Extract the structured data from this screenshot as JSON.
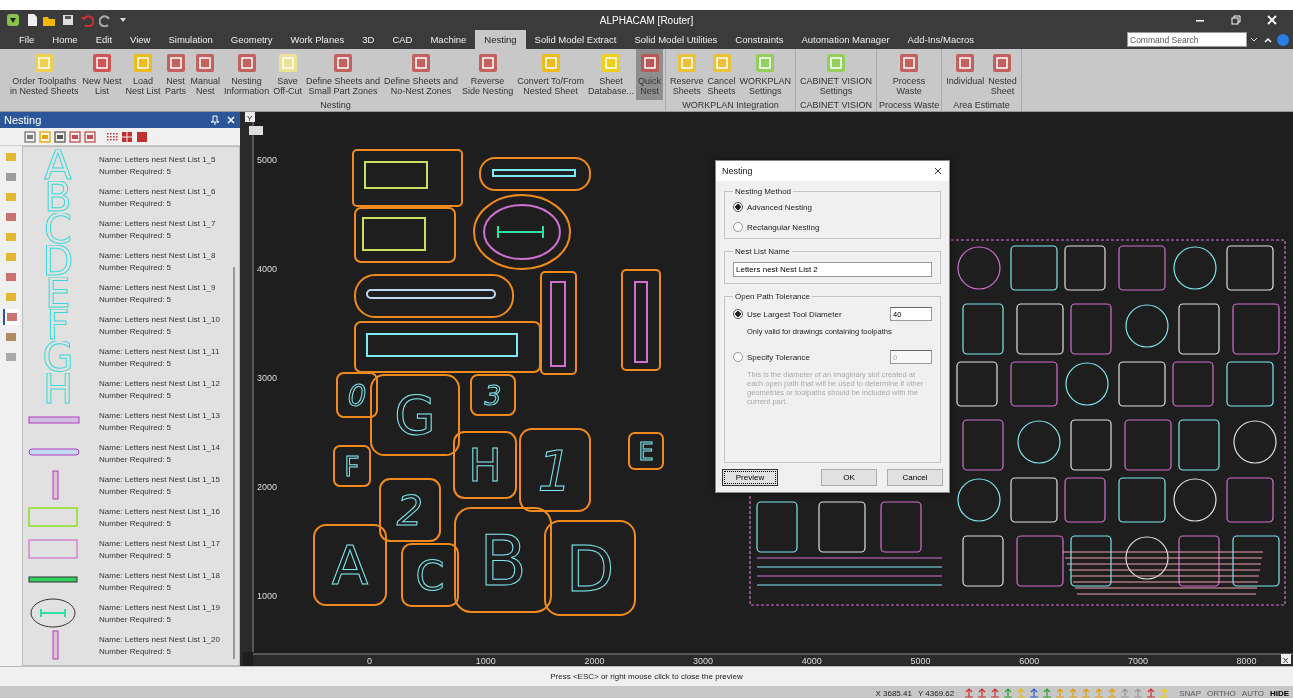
{
  "window": {
    "title": "ALPHACAM [Router]"
  },
  "menu_tabs": [
    {
      "label": "File",
      "selected": false
    },
    {
      "label": "Home",
      "selected": false
    },
    {
      "label": "Edit",
      "selected": false
    },
    {
      "label": "View",
      "selected": false
    },
    {
      "label": "Simulation",
      "selected": false
    },
    {
      "label": "Geometry",
      "selected": false
    },
    {
      "label": "Work Planes",
      "selected": false
    },
    {
      "label": "3D",
      "selected": false
    },
    {
      "label": "CAD",
      "selected": false
    },
    {
      "label": "Machine",
      "selected": false
    },
    {
      "label": "Nesting",
      "selected": true
    },
    {
      "label": "Solid Model Extract",
      "selected": false
    },
    {
      "label": "Solid Model Utilities",
      "selected": false
    },
    {
      "label": "Constraints",
      "selected": false
    },
    {
      "label": "Automation Manager",
      "selected": false
    },
    {
      "label": "Add-Ins/Macros",
      "selected": false
    }
  ],
  "command_search": {
    "placeholder": "Command Search"
  },
  "ribbon_groups": [
    {
      "label": "Nesting",
      "buttons": [
        {
          "label": "Order Toolpaths\nin Nested Sheets",
          "selected": false
        },
        {
          "label": "New Nest\nList",
          "selected": false
        },
        {
          "label": "Load\nNest List",
          "selected": false
        },
        {
          "label": "Nest\nParts",
          "selected": false
        },
        {
          "label": "Manual\nNest",
          "selected": false
        },
        {
          "label": "Nesting\nInformation",
          "selected": false
        },
        {
          "label": "Save\nOff-Cut",
          "selected": false
        },
        {
          "label": "Define Sheets and\nSmall Part Zones",
          "selected": false
        },
        {
          "label": "Define Sheets and\nNo-Nest Zones",
          "selected": false
        },
        {
          "label": "Reverse\nSide Nesting",
          "selected": false
        },
        {
          "label": "Convert To/From\nNested Sheet",
          "selected": false
        },
        {
          "label": "Sheet\nDatabase...",
          "selected": false
        },
        {
          "label": "Quick\nNest",
          "selected": true
        }
      ]
    },
    {
      "label": "WORKPLAN Integration",
      "buttons": [
        {
          "label": "Reserve\nSheets",
          "selected": false
        },
        {
          "label": "Cancel\nSheets",
          "selected": false
        },
        {
          "label": "WORKPLAN\nSettings",
          "selected": false
        }
      ]
    },
    {
      "label": "CABINET VISION",
      "buttons": [
        {
          "label": "CABINET VISION\nSettings",
          "selected": false
        }
      ]
    },
    {
      "label": "Process Waste",
      "buttons": [
        {
          "label": "Process\nWaste",
          "selected": false
        }
      ]
    },
    {
      "label": "Area Estimate",
      "buttons": [
        {
          "label": "Individual",
          "selected": false
        },
        {
          "label": "Nested\nSheet",
          "selected": false
        }
      ]
    }
  ],
  "panel": {
    "title": "Nesting",
    "side_tabs": [
      {
        "selected": false
      },
      {
        "selected": false
      },
      {
        "selected": false
      },
      {
        "selected": false
      },
      {
        "selected": false
      },
      {
        "selected": false
      },
      {
        "selected": false
      },
      {
        "selected": false
      },
      {
        "selected": true
      },
      {
        "selected": false
      },
      {
        "selected": false
      }
    ],
    "items": [
      {
        "name": "Name: Letters nest Nest List 1_5",
        "count": "Number Required: 5",
        "kind": "letter",
        "glyph": "A"
      },
      {
        "name": "Name: Letters nest Nest List 1_6",
        "count": "Number Required: 5",
        "kind": "letter",
        "glyph": "B"
      },
      {
        "name": "Name: Letters nest Nest List 1_7",
        "count": "Number Required: 5",
        "kind": "letter",
        "glyph": "C"
      },
      {
        "name": "Name: Letters nest Nest List 1_8",
        "count": "Number Required: 5",
        "kind": "letter",
        "glyph": "D"
      },
      {
        "name": "Name: Letters nest Nest List 1_9",
        "count": "Number Required: 5",
        "kind": "letter",
        "glyph": "E"
      },
      {
        "name": "Name: Letters nest Nest List 1_10",
        "count": "Number Required: 5",
        "kind": "letter",
        "glyph": "F"
      },
      {
        "name": "Name: Letters nest Nest List 1_11",
        "count": "Number Required: 5",
        "kind": "letter",
        "glyph": "G"
      },
      {
        "name": "Name: Letters nest Nest List 1_12",
        "count": "Number Required: 5",
        "kind": "letter",
        "glyph": "H"
      },
      {
        "name": "Name: Letters nest Nest List 1_13",
        "count": "Number Required: 5",
        "kind": "bar"
      },
      {
        "name": "Name: Letters nest Nest List 1_14",
        "count": "Number Required: 5",
        "kind": "rounded-bar"
      },
      {
        "name": "Name: Letters nest Nest List 1_15",
        "count": "Number Required: 5",
        "kind": "slot"
      },
      {
        "name": "Name: Letters nest Nest List 1_16",
        "count": "Number Required: 5",
        "kind": "frame"
      },
      {
        "name": "Name: Letters nest Nest List 1_17",
        "count": "Number Required: 5",
        "kind": "frame-pink"
      },
      {
        "name": "Name: Letters nest Nest List 1_18",
        "count": "Number Required: 5",
        "kind": "strip"
      },
      {
        "name": "Name: Letters nest Nest List 1_19",
        "count": "Number Required: 5",
        "kind": "ellipse"
      },
      {
        "name": "Name: Letters nest Nest List 1_20",
        "count": "Number Required: 5",
        "kind": "slot"
      }
    ]
  },
  "canvas": {
    "y_axis_label": "Y",
    "x_axis_label": "X",
    "y_ticks": [
      "5000",
      "4000",
      "3000",
      "2000",
      "1000"
    ],
    "x_ticks": [
      "0",
      "1000",
      "2000",
      "3000",
      "4000",
      "5000",
      "6000",
      "7000",
      "8000"
    ],
    "letter_parts": [
      {
        "glyph": "0"
      },
      {
        "glyph": "G"
      },
      {
        "glyph": "3"
      },
      {
        "glyph": "F"
      },
      {
        "glyph": "H"
      },
      {
        "glyph": "1"
      },
      {
        "glyph": "E"
      },
      {
        "glyph": "2"
      },
      {
        "glyph": "A"
      },
      {
        "glyph": "C"
      },
      {
        "glyph": "B"
      },
      {
        "glyph": "D"
      }
    ]
  },
  "dialog": {
    "title": "Nesting",
    "method": {
      "label": "Nesting Method",
      "options": [
        {
          "label": "Advanced Nesting",
          "selected": true
        },
        {
          "label": "Rectangular Nesting",
          "selected": false
        }
      ]
    },
    "name_group": {
      "label": "Nest List Name",
      "value": "Letters nest Nest List 2"
    },
    "tolerance": {
      "label": "Open Path Tolerance",
      "options": [
        {
          "label": "Use Largest Tool Diameter",
          "selected": true,
          "value": "40",
          "note": "Only valid for drawings containing toolpaths"
        },
        {
          "label": "Specify Tolerance",
          "selected": false,
          "value": "0",
          "note": "This is the diameter of an imaginary slot created at each open path that will be used to determine if other geometries or toolpaths should be included with the current part."
        }
      ]
    },
    "buttons": [
      {
        "label": "Preview",
        "focused": true
      },
      {
        "label": "OK",
        "focused": false
      },
      {
        "label": "Cancel",
        "focused": false
      }
    ]
  },
  "prompt": "Press <ESC> or right mouse click to close the preview",
  "status_bar": {
    "x": "X 3685.41",
    "y": "Y 4369.62",
    "toggles": [
      {
        "label": "SNAP",
        "on": false
      },
      {
        "label": "ORTHO",
        "on": false
      },
      {
        "label": "AUTO",
        "on": false
      },
      {
        "label": "HIDE",
        "on": true
      }
    ]
  }
}
